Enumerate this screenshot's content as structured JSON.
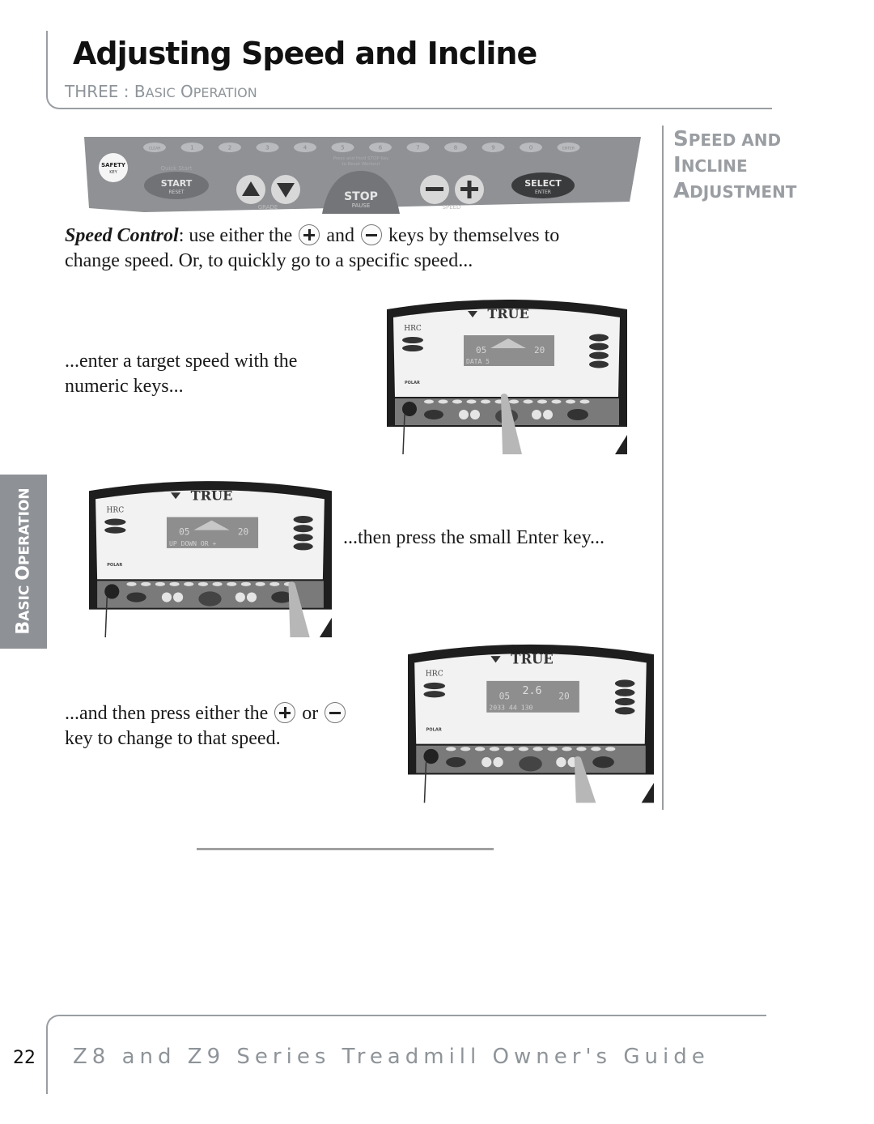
{
  "header": {
    "title": "Adjusting Speed and Incline",
    "chapter_prefix": "THREE : ",
    "chapter_b": "B",
    "chapter_b_rest": "ASIC",
    "chapter_o": "O",
    "chapter_o_rest": "PERATION"
  },
  "side_title": {
    "line1_cap": "S",
    "line1_rest": "PEED AND",
    "line2_cap": "I",
    "line2_rest": "NCLINE",
    "line3_cap": "A",
    "line3_rest": "DJUSTMENT"
  },
  "side_tab": {
    "cap1": "B",
    "rest1": "ASIC ",
    "cap2": "O",
    "rest2": "PERATION"
  },
  "keypad": {
    "safety": "SAFETY",
    "safety_sub": "KEY",
    "numeric_keys": [
      "CLEAR",
      "1",
      "2",
      "3",
      "4",
      "5",
      "6",
      "7",
      "8",
      "9",
      "0",
      "ENTER"
    ],
    "quick_start": "Quick Start",
    "start": "START",
    "start_sub": "RESET",
    "grade": "GRADE",
    "stop_hint_1": "Press and Hold STOP Key",
    "stop_hint_2": "to Reset Workout",
    "stop": "STOP",
    "stop_sub": "PAUSE",
    "speed": "SPEED",
    "select": "SELECT",
    "select_sub": "ENTER"
  },
  "instructions": {
    "speed_control_label": "Speed Control",
    "p1_a": ": use either the ",
    "p1_and": " and ",
    "p1_b": " keys by themselves to",
    "p1_c": "change speed. Or, to quickly go to a specific speed...",
    "step2_l1": "...enter a target speed with the",
    "step2_l2": "numeric keys...",
    "step3": "...then press the small Enter key...",
    "step4_a": "...and then press either the ",
    "step4_or": " or ",
    "step4_l2": "key to change to that speed."
  },
  "photos": [
    {
      "brand": "TRUE",
      "hrc": "HRC",
      "display_left": "05",
      "display_right": "20",
      "display_bottom": "DATA   5",
      "polar": "POLAR"
    },
    {
      "brand": "TRUE",
      "hrc": "HRC",
      "display_left": "05",
      "display_right": "20",
      "display_bottom": "UP DOWN OR +",
      "polar": "POLAR"
    },
    {
      "brand": "TRUE",
      "hrc": "HRC",
      "display_left": "05",
      "display_center": "2.6",
      "display_right": "20",
      "display_bottom": "2033  44     130",
      "polar": "POLAR"
    }
  ],
  "footer": {
    "page_number": "22",
    "guide_title": "Z8 and Z9 Series Treadmill Owner's Guide"
  }
}
